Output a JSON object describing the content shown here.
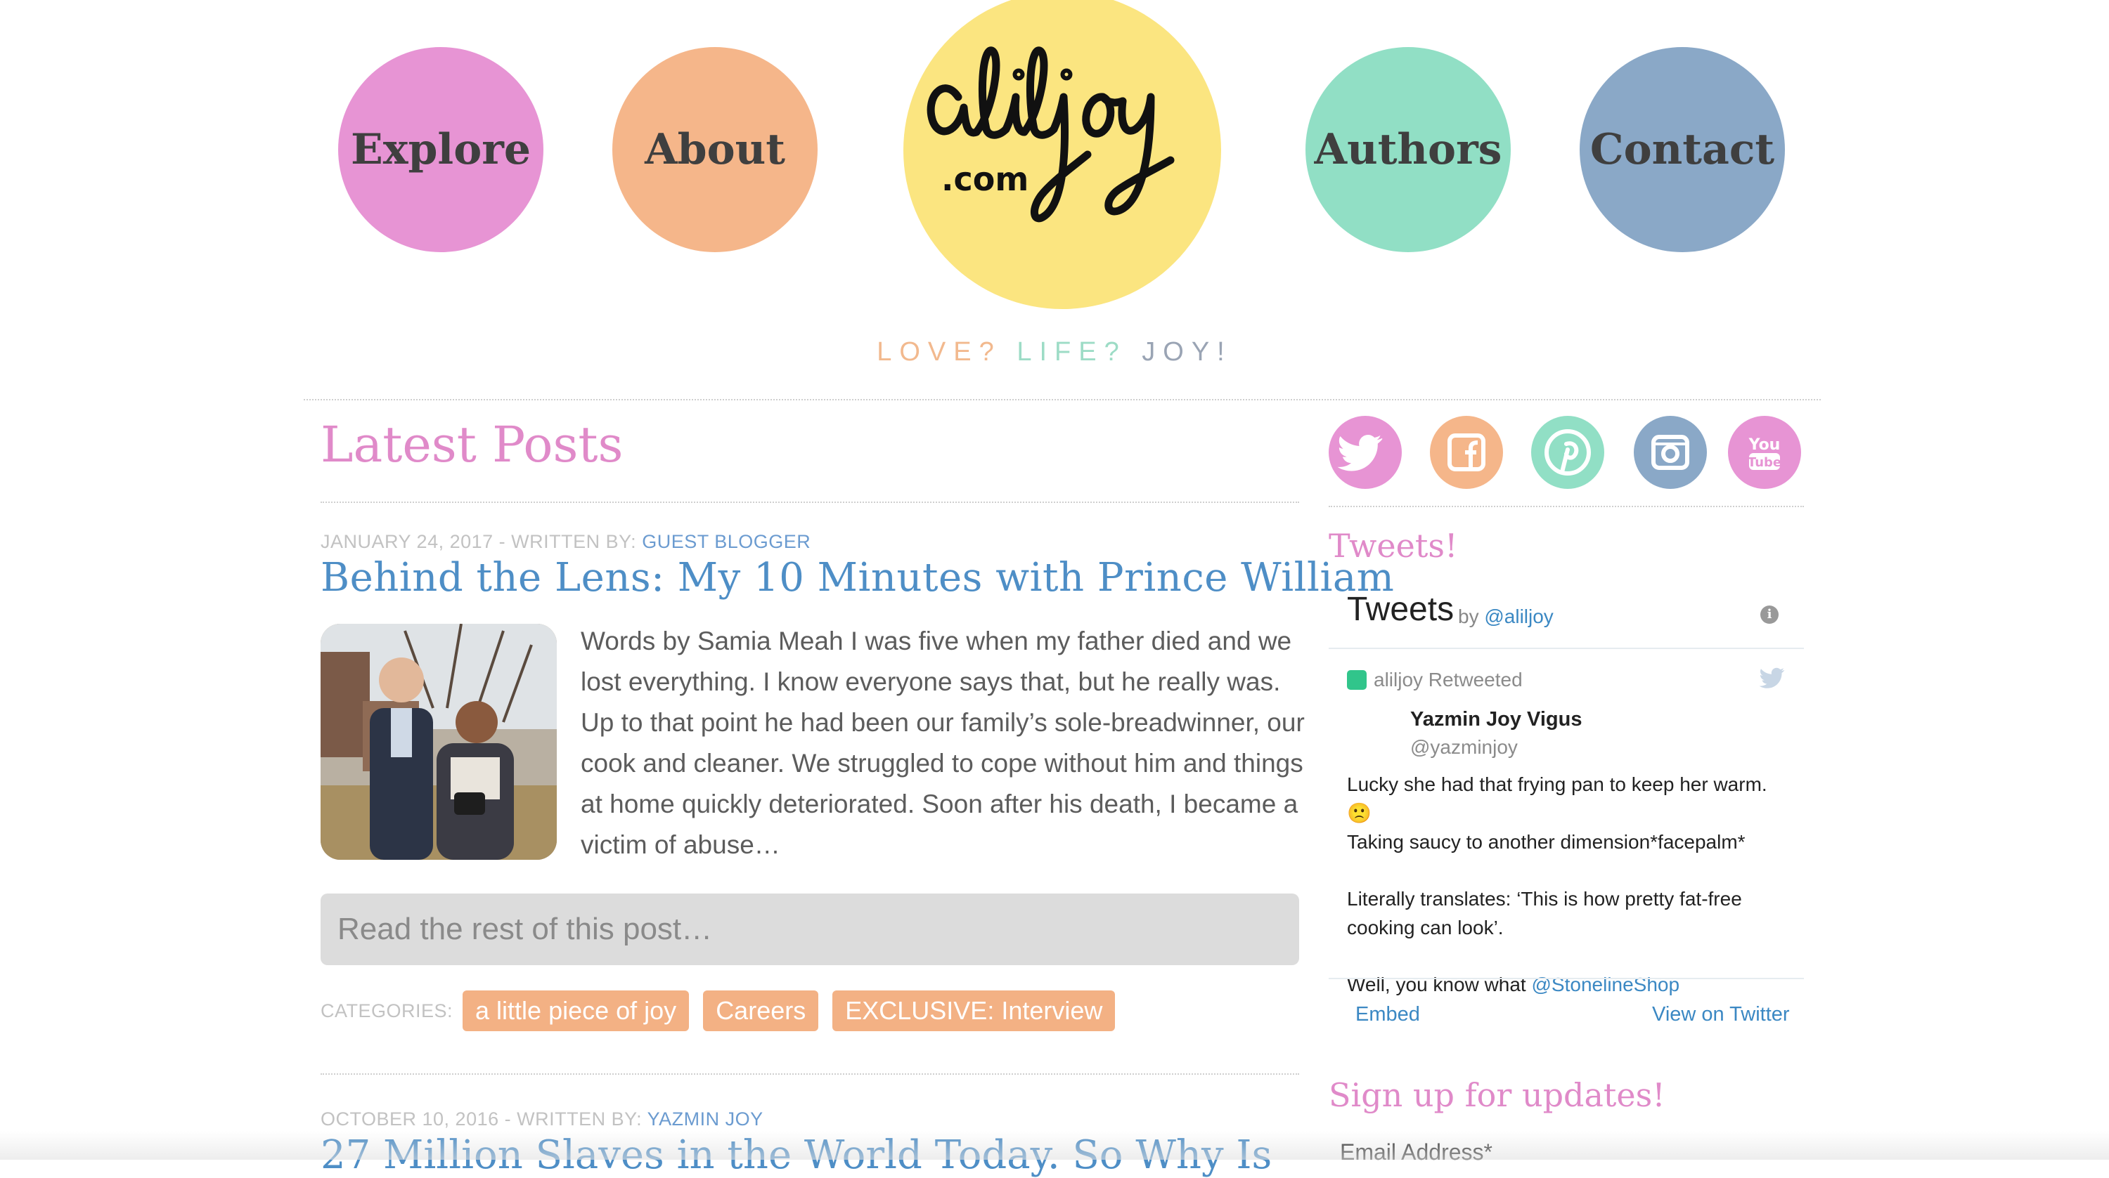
{
  "nav": {
    "explore": "Explore",
    "about": "About",
    "authors": "Authors",
    "contact": "Contact",
    "logo_com": ".com",
    "logo_text": "aliljoy"
  },
  "tagline": {
    "part1": "LOVE?",
    "part2": "LIFE?",
    "part3": "JOY!"
  },
  "main": {
    "section_title": "Latest Posts",
    "posts": [
      {
        "date": "JANUARY 24, 2017",
        "written_by": "- WRITTEN BY:",
        "author": "GUEST BLOGGER",
        "title": "Behind the Lens: My 10 Minutes with Prince William",
        "excerpt": "Words by Samia Meah I was five when my father died and we lost everything. I know everyone says that, but he really was. Up to that point he had been our family’s sole-breadwinner, our cook and cleaner. We struggled to cope without him and things at home quickly deteriorated. Soon after his death, I became a victim of abuse…",
        "read_more": "Read the rest of this post…",
        "categories_label": "CATEGORIES:",
        "categories": [
          "a little piece of joy",
          "Careers",
          "EXCLUSIVE: Interview"
        ]
      },
      {
        "date": "OCTOBER 10, 2016",
        "written_by": "- WRITTEN BY:",
        "author": "YAZMIN JOY",
        "title": "27 Million Slaves in the World Today. So Why Is"
      }
    ]
  },
  "sidebar": {
    "social": [
      "twitter-icon",
      "facebook-icon",
      "pinterest-icon",
      "instagram-icon",
      "youtube-icon"
    ],
    "tweets_heading": "Tweets!",
    "widget": {
      "title": "Tweets",
      "by": "by",
      "handle": "@aliljoy",
      "retweeted": "aliljoy Retweeted",
      "name": "Yazmin Joy Vigus",
      "username": "@yazminjoy",
      "line1": "Lucky she had that frying pan to keep her warm. 🙁",
      "line2": "Taking saucy to another dimension*facepalm*",
      "line3": "Literally translates: ‘This is how pretty fat-free",
      "line4": "cooking can look’.",
      "line5_prefix": "Well, you know what ",
      "line5_mention": "@StonelineShop",
      "embed": "Embed",
      "view": "View on Twitter"
    },
    "signup_heading": "Sign up for updates!",
    "email_label": "Email Address*"
  },
  "colors": {
    "pink": "#e794d4",
    "orange": "#f5b68a",
    "mint": "#91dfc5",
    "slate": "#8aa8c7",
    "yellow": "#fbe580",
    "link_blue": "#4e8ec6"
  }
}
